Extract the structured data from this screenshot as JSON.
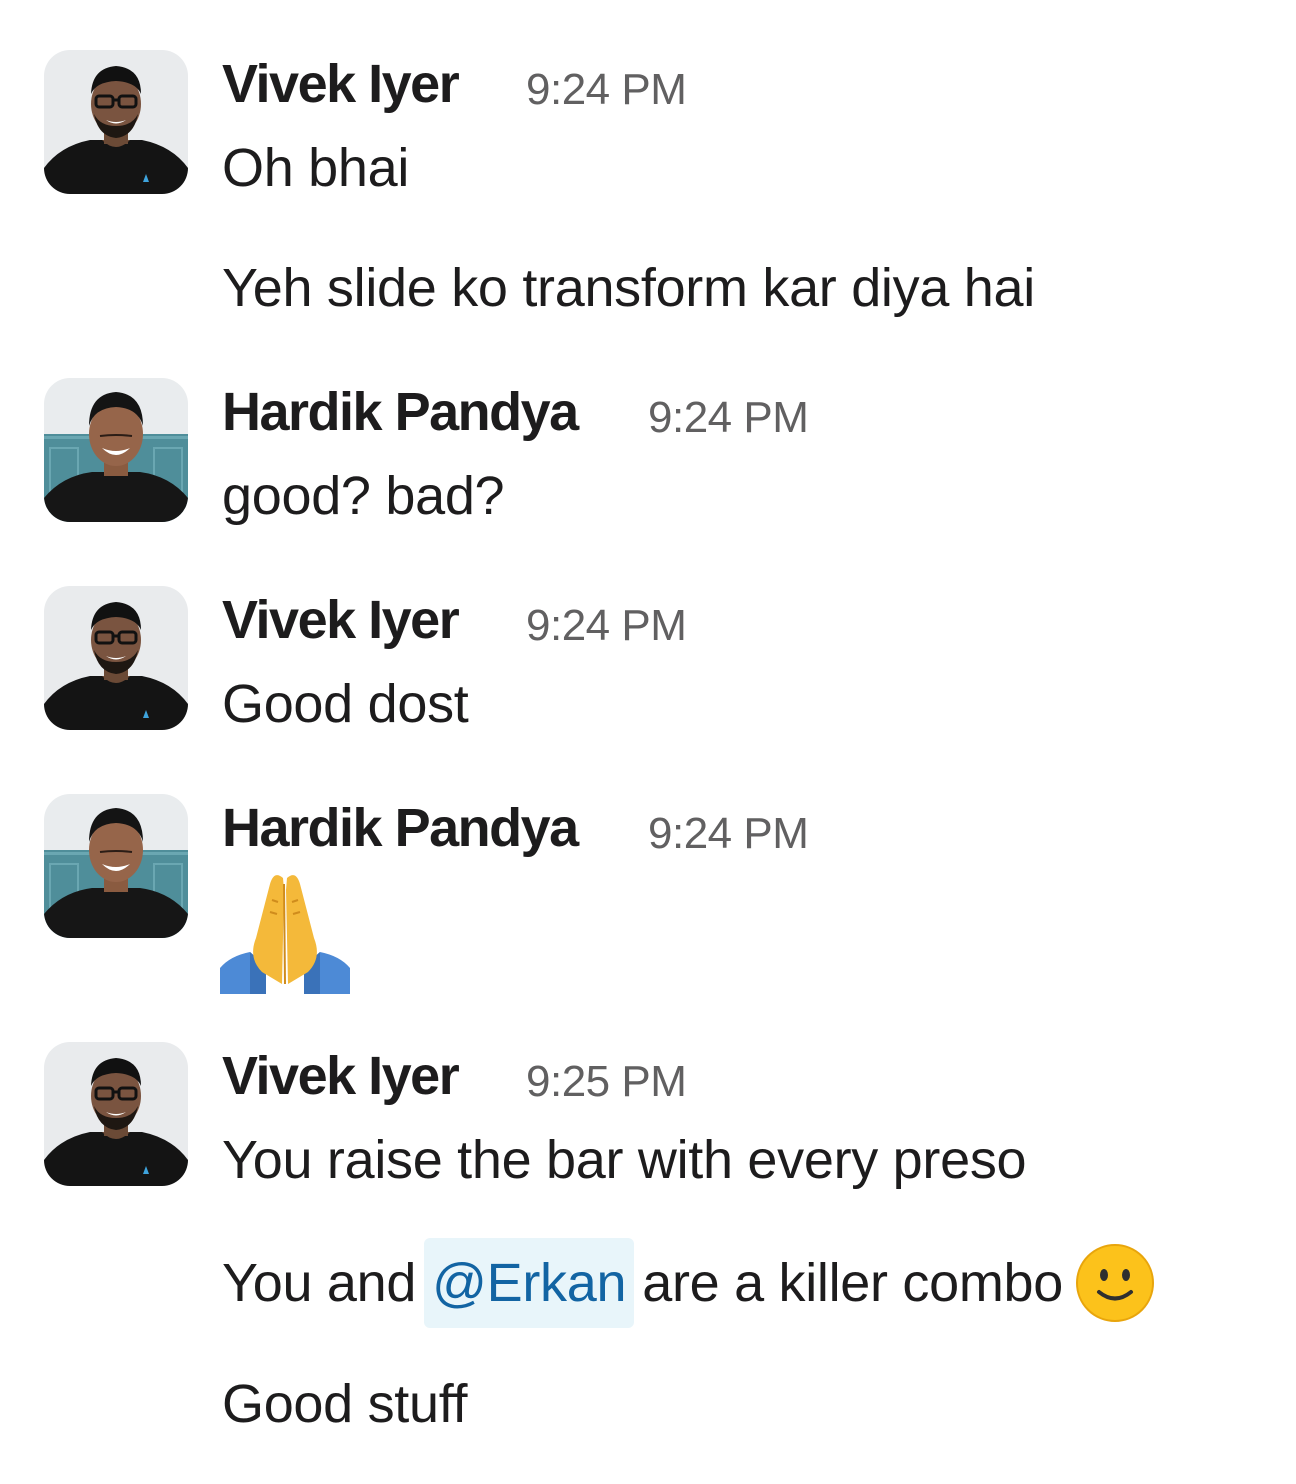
{
  "messages": [
    {
      "author": "Vivek Iyer",
      "time": "9:24 PM",
      "avatar": "vivek-avatar",
      "lines": [
        "Oh bhai",
        "Yeh slide ko transform kar diya hai"
      ]
    },
    {
      "author": "Hardik Pandya",
      "time": "9:24 PM",
      "avatar": "hardik-avatar",
      "lines": [
        "good? bad?"
      ]
    },
    {
      "author": "Vivek Iyer",
      "time": "9:24 PM",
      "avatar": "vivek-avatar",
      "lines": [
        "Good dost"
      ]
    },
    {
      "author": "Hardik Pandya",
      "time": "9:24 PM",
      "avatar": "hardik-avatar",
      "emoji": "folded-hands-emoji"
    },
    {
      "author": "Vivek Iyer",
      "time": "9:25 PM",
      "avatar": "vivek-avatar",
      "lines": [
        "You raise the bar with every preso"
      ],
      "mention_line": {
        "before": "You and",
        "mention": "@Erkan",
        "after": "are a killer combo",
        "emoji": "slightly-smiling-face-emoji"
      },
      "last_line": "Good stuff"
    }
  ],
  "colors": {
    "mention_bg": "#e8f5fa",
    "mention_text": "#1264a3",
    "timestamp": "#616061",
    "text": "#1d1c1d"
  }
}
